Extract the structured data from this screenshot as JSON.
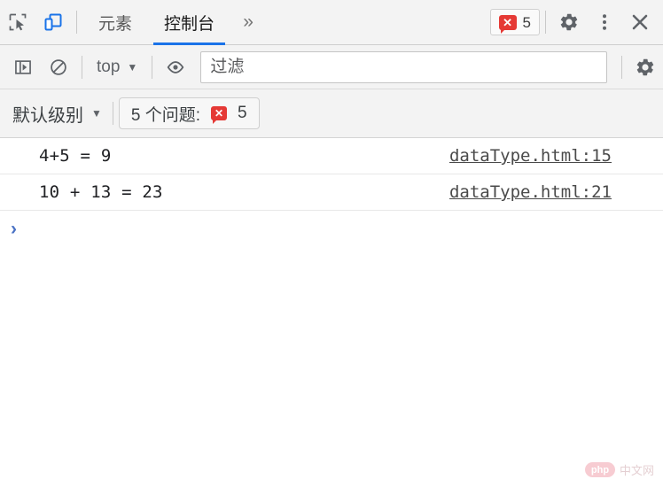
{
  "tabbar": {
    "inspect_icon": "inspect-cursor-icon",
    "device_icon": "device-toolbar-icon",
    "tabs": [
      {
        "label": "元素",
        "active": false
      },
      {
        "label": "控制台",
        "active": true
      }
    ],
    "more_tabs_label": "»",
    "error_badge": {
      "icon": "error-bubble-icon",
      "count": "5"
    },
    "settings_icon": "gear-icon",
    "menu_icon": "kebab-menu-icon",
    "close_icon": "close-icon"
  },
  "filterbar": {
    "sidebar_icon": "console-sidebar-icon",
    "clear_icon": "clear-console-icon",
    "context": {
      "label": "top",
      "caret": "▼"
    },
    "eye_icon": "live-expression-eye-icon",
    "filter": {
      "placeholder": "过滤",
      "value": ""
    },
    "settings_icon": "gear-icon"
  },
  "levelbar": {
    "level": {
      "label": "默认级别",
      "caret": "▼"
    },
    "issues": {
      "label": "5 个问题:",
      "icon": "error-bubble-icon",
      "count": "5"
    }
  },
  "console": {
    "messages": [
      {
        "text": "4+5 = 9",
        "source": "dataType.html:15"
      },
      {
        "text": "10 + 13 = 23",
        "source": "dataType.html:21"
      }
    ],
    "prompt_chevron": "›"
  },
  "watermark": {
    "logo": "php",
    "text": "中文网"
  },
  "colors": {
    "accent": "#1a73e8",
    "error": "#e53935",
    "toolbar_bg": "#f3f3f3",
    "console_bg": "#ffffff",
    "prompt": "#4a72c4"
  }
}
